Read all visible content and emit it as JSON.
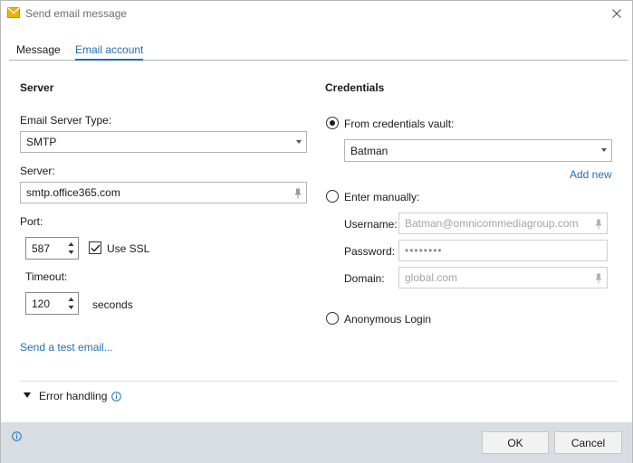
{
  "window": {
    "title": "Send email message"
  },
  "tabs": [
    {
      "label": "Message",
      "active": false
    },
    {
      "label": "Email account",
      "active": true
    }
  ],
  "server": {
    "section_title": "Server",
    "type_label": "Email Server Type:",
    "type_value": "SMTP",
    "server_label": "Server:",
    "server_value": "smtp.office365.com",
    "port_label": "Port:",
    "port_value": "587",
    "use_ssl_label": "Use SSL",
    "use_ssl_checked": true,
    "timeout_label": "Timeout:",
    "timeout_value": "120",
    "timeout_unit": "seconds",
    "test_link": "Send a test email..."
  },
  "credentials": {
    "section_title": "Credentials",
    "vault_label": "From credentials vault:",
    "vault_selected": true,
    "vault_value": "Batman",
    "add_new": "Add new",
    "manual_label": "Enter manually:",
    "manual_selected": false,
    "username_label": "Username:",
    "username_value": "Batman@omnicommediagroup.com",
    "password_label": "Password:",
    "password_value": "••••••••",
    "domain_label": "Domain:",
    "domain_value": "global.com",
    "anonymous_label": "Anonymous Login",
    "anonymous_selected": false
  },
  "error_handling": {
    "label": "Error handling"
  },
  "footer": {
    "ok_label": "OK",
    "cancel_label": "Cancel"
  },
  "colors": {
    "accent": "#1f6fb5",
    "footer_bg": "#d7dde3",
    "title_icon": "#f2b200"
  },
  "icons": {
    "title": "envelope-icon",
    "close": "close-icon",
    "dropdown": "chevron-down-icon",
    "pin": "pin-icon",
    "info": "info-icon",
    "expand": "triangle-down-icon",
    "check": "checkmark-icon"
  }
}
